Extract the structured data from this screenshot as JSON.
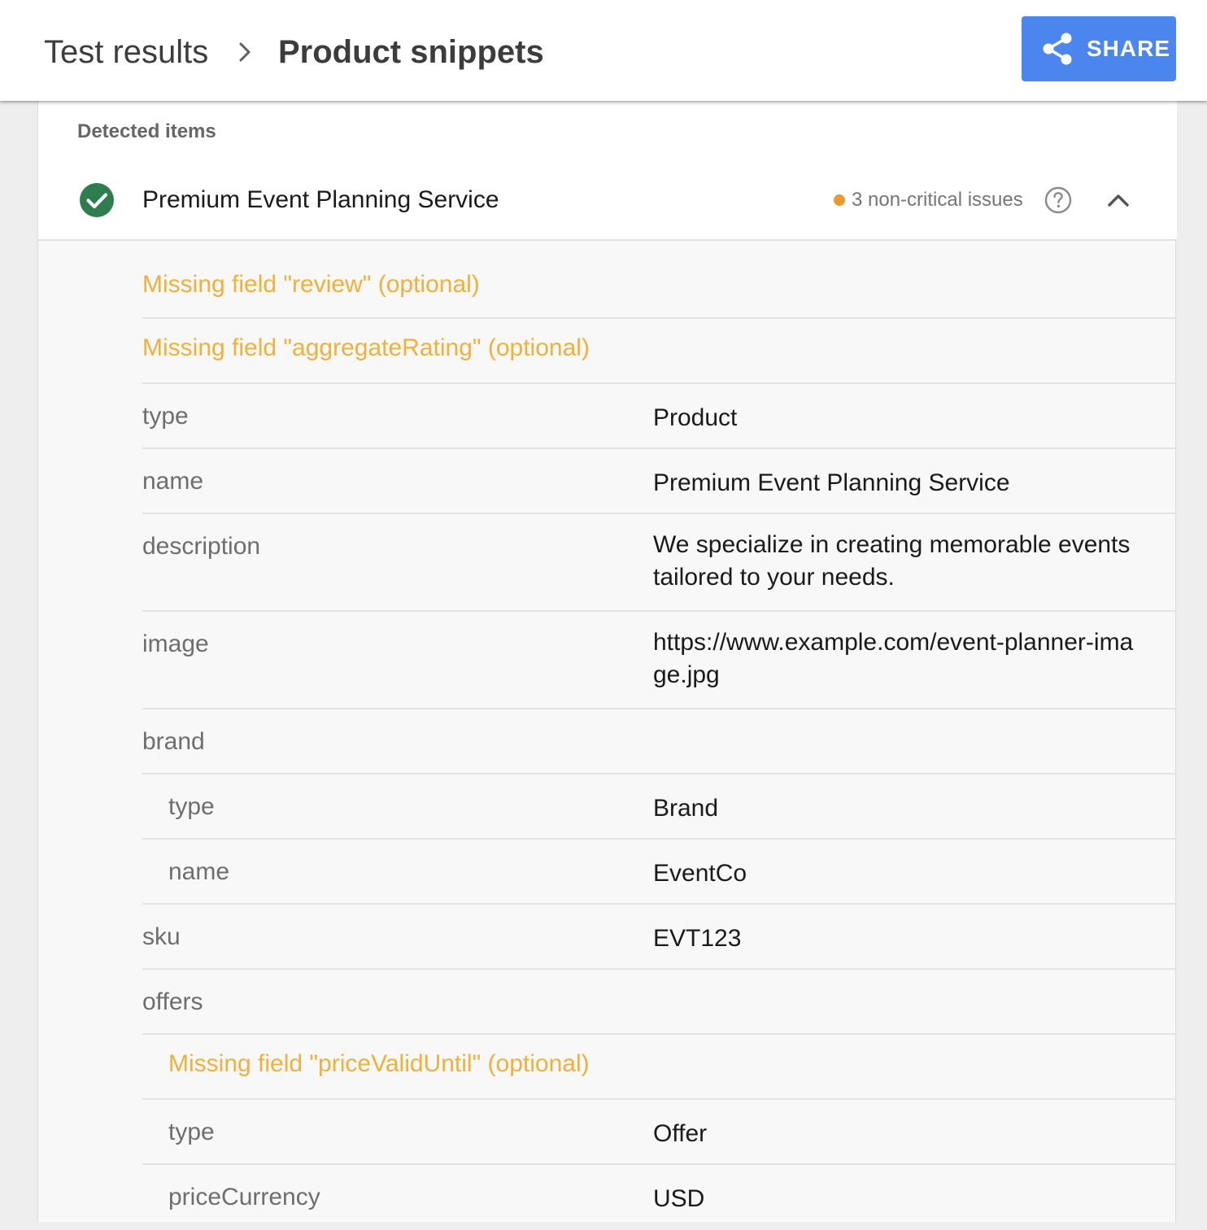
{
  "header": {
    "breadcrumb_root": "Test results",
    "breadcrumb_current": "Product snippets",
    "share_label": "SHARE"
  },
  "colors": {
    "share_button": "#4b85ee",
    "success_check": "#2e7d4f",
    "warning_text": "#f0b03a",
    "issue_dot": "#e89a2a"
  },
  "detected": {
    "section_label": "Detected items",
    "item_title": "Premium Event Planning Service",
    "issues_label": "3 non-critical issues",
    "status_icon": "check-circle-icon",
    "help_icon": "help-circle-icon",
    "toggle_icon": "chevron-up-icon"
  },
  "rows": {
    "warn_review": "Missing field \"review\" (optional)",
    "warn_rating": "Missing field \"aggregateRating\" (optional)",
    "type_label": "type",
    "type_value": "Product",
    "name_label": "name",
    "name_value": "Premium Event Planning Service",
    "description_label": "description",
    "description_value": "We specialize in creating memorable events tailored to your needs.",
    "image_label": "image",
    "image_value": "https://www.example.com/event-planner-image.jpg",
    "brand_label": "brand",
    "brand_type_label": "type",
    "brand_type_value": "Brand",
    "brand_name_label": "name",
    "brand_name_value": "EventCo",
    "sku_label": "sku",
    "sku_value": "EVT123",
    "offers_label": "offers",
    "warn_price_valid": "Missing field \"priceValidUntil\" (optional)",
    "offer_type_label": "type",
    "offer_type_value": "Offer",
    "price_currency_label": "priceCurrency",
    "price_currency_value": "USD"
  }
}
